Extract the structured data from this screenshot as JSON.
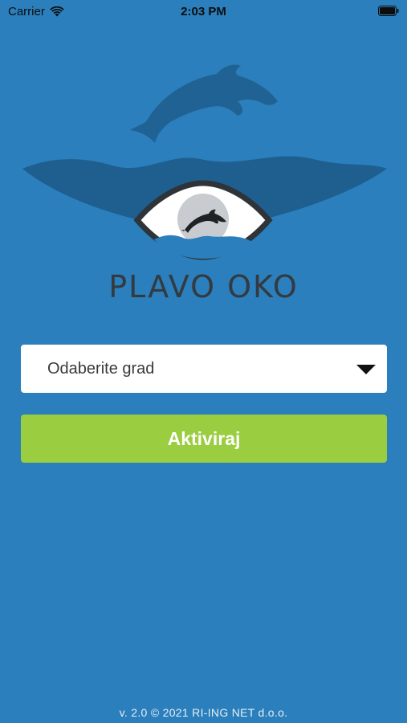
{
  "status_bar": {
    "carrier": "Carrier",
    "time": "2:03 PM",
    "icons": [
      "wifi-icon",
      "battery-icon"
    ]
  },
  "logo": {
    "brand_name": "PLAVO OKO",
    "icons": [
      "dolphin-icon",
      "eye-icon",
      "wave-icon"
    ]
  },
  "city_select": {
    "placeholder": "Odaberite grad",
    "icon": "chevron-down-icon"
  },
  "activate_button": {
    "label": "Aktiviraj"
  },
  "footer": {
    "text": "v. 2.0 © 2021 RI-ING NET d.o.o."
  },
  "colors": {
    "background": "#2a7fbc",
    "button": "#9acd3f",
    "brand_text": "#333a40",
    "select_bg": "#ffffff"
  }
}
